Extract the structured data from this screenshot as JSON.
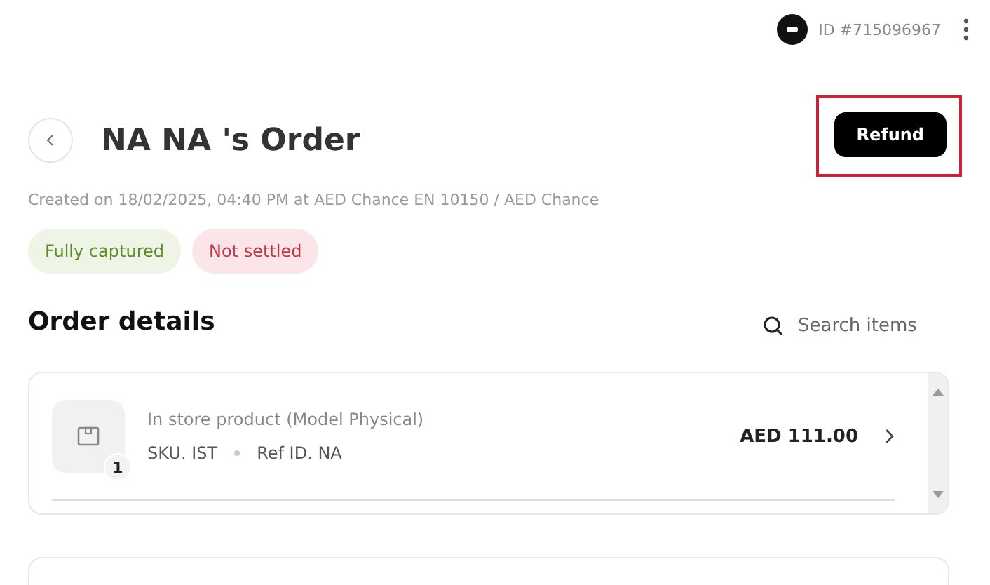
{
  "header": {
    "account_id": "ID #715096967"
  },
  "order": {
    "title": "NA NA 's Order",
    "subtitle": "Created on 18/02/2025, 04:40 PM at AED Chance EN 10150 / AED Chance",
    "refund_button": {
      "label": "Refund",
      "highlighted": true
    },
    "badges": [
      {
        "label": "Fully captured",
        "kind": "success"
      },
      {
        "label": "Not settled",
        "kind": "danger"
      }
    ]
  },
  "order_details": {
    "heading": "Order details",
    "search": {
      "placeholder": "Search items"
    },
    "items": [
      {
        "name": "In store product (Model Physical)",
        "quantity": "1",
        "sku": "SKU. IST",
        "ref": "Ref ID. NA",
        "price": "AED 111.00"
      }
    ]
  }
}
